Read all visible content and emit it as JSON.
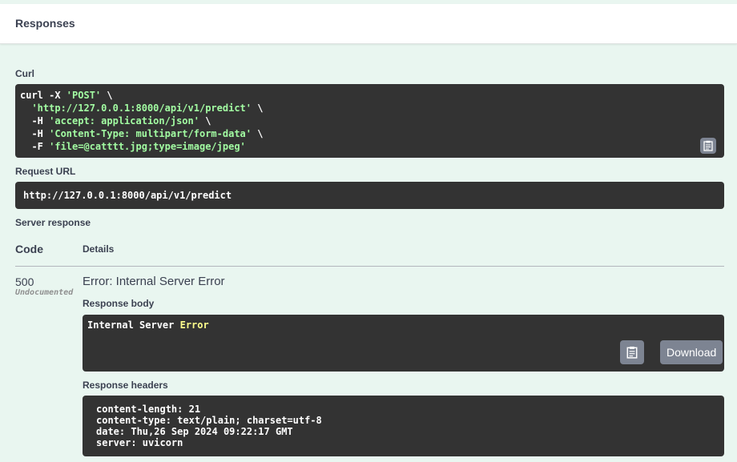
{
  "header": {
    "title": "Responses"
  },
  "curl": {
    "label": "Curl",
    "lines": [
      {
        "prefix": "curl -X ",
        "str": "'POST'",
        "suffix": " \\"
      },
      {
        "prefix": "  ",
        "str": "'http://127.0.0.1:8000/api/v1/predict'",
        "suffix": " \\"
      },
      {
        "prefix": "  -H ",
        "str": "'accept: application/json'",
        "suffix": " \\"
      },
      {
        "prefix": "  -H ",
        "str": "'Content-Type: multipart/form-data'",
        "suffix": " \\"
      },
      {
        "prefix": "  -F ",
        "str": "'file=@catttt.jpg;type=image/jpeg'",
        "suffix": ""
      }
    ]
  },
  "request_url": {
    "label": "Request URL",
    "value": "http://127.0.0.1:8000/api/v1/predict"
  },
  "server_response": {
    "label": "Server response",
    "code_header": "Code",
    "details_header": "Details",
    "row": {
      "code": "500",
      "undocumented": "Undocumented",
      "error_title": "Error: Internal Server Error",
      "response_body_label": "Response body",
      "body_text_plain": "Internal Server ",
      "body_text_highlight": "Error",
      "download_label": "Download",
      "response_headers_label": "Response headers",
      "headers": [
        "content-length: 21",
        "content-type: text/plain; charset=utf-8",
        "date: Thu,26 Sep 2024 09:22:17 GMT",
        "server: uvicorn"
      ]
    }
  },
  "icons": {
    "copy": "clipboard-icon"
  },
  "colors": {
    "background": "#e9f6f0",
    "code_bg": "#333333",
    "string": "#a2fca2",
    "button": "#7d8492",
    "highlight": "#fcfc8c"
  }
}
